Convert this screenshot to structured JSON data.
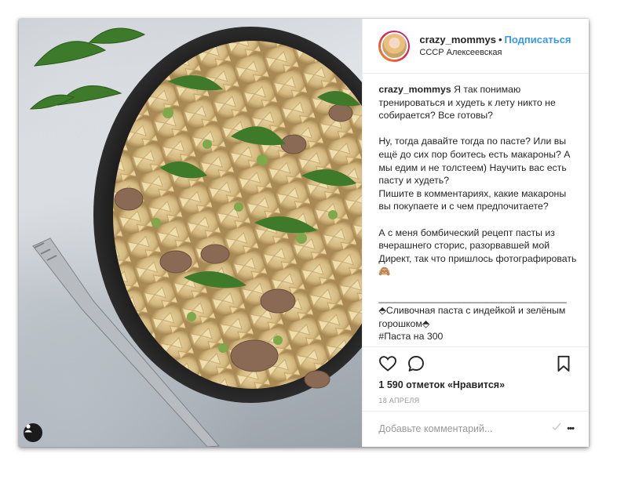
{
  "post": {
    "username": "crazy_mommys",
    "separator": "•",
    "follow_label": "Подписаться",
    "location": "СССР Алексеевская",
    "caption_user": "crazy_mommys",
    "caption_text": " Я так понимаю тренироваться и худеть к лету никто не собирается? Все готовы?\n\nНу, тогда давайте тогда по пасте? Или вы ещё до сих пор боитесь есть макароны? А мы едим и не толстеем) Научить вас есть пасту и худеть?\nПишите в комментариях, какие макароны вы покупаете и с чем предпочитаете?\n\nА с меня бомбический рецепт пасты из вчерашнего сторис, разорвавшей мой Директ, так что пришлось фотографировать🙈\n\n___________________________________\n⬘Сливочная паста с индейкой и зелёным горошком⬘\n#Паста на 300",
    "likes": "1 590 отметок «Нравится»",
    "date": "18 апреля",
    "comment_placeholder": "Добавьте комментарий...",
    "more_label": "•••"
  },
  "icons": {
    "like": "heart-icon",
    "comment": "speech-bubble-icon",
    "save": "bookmark-icon",
    "tag": "user-tag-icon",
    "more": "more-dots-icon"
  },
  "colors": {
    "follow": "#3897f0",
    "text": "#262626",
    "muted": "#999999"
  }
}
